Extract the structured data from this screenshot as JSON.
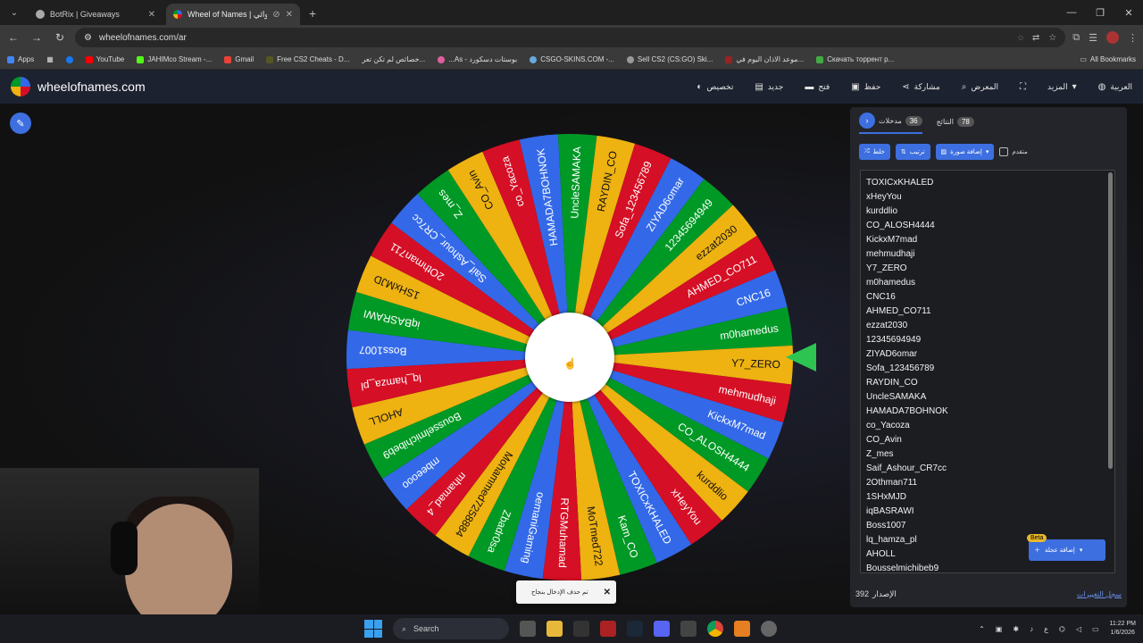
{
  "browser": {
    "tabs": [
      {
        "title": "BotRix | Giveaways",
        "active": false
      },
      {
        "title": "Wheel of Names | العشوائي",
        "active": true
      }
    ],
    "url": "wheelofnames.com/ar",
    "bookmarks": [
      "Apps",
      "YouTube",
      "JAHIMco Stream -...",
      "Gmail",
      "Free CS2 Cheats - D...",
      "خصائص لم تكن تعر...",
      "...As - بوستات دسكورد",
      "CSGO-SKINS.COM -...",
      "Sell CS2 (CS:GO) Ski...",
      "موعد الاذان اليوم في...",
      "Скачать торрент р..."
    ],
    "all_bookmarks": "All Bookmarks"
  },
  "header": {
    "site_name": "wheelofnames.com",
    "menu": [
      {
        "label": "العربية",
        "icon": "globe-icon"
      },
      {
        "label": "المزيد",
        "icon": "chevron-down-icon"
      },
      {
        "label": "",
        "icon": "fullscreen-icon"
      },
      {
        "label": "المعرض",
        "icon": "search-icon"
      },
      {
        "label": "مشاركة",
        "icon": "share-icon"
      },
      {
        "label": "حفظ",
        "icon": "save-icon"
      },
      {
        "label": "فتح",
        "icon": "folder-icon"
      },
      {
        "label": "جديد",
        "icon": "new-file-icon"
      },
      {
        "label": "تخصيص",
        "icon": "palette-icon"
      }
    ]
  },
  "panel": {
    "tab_entries_label": "مدخلات",
    "tab_entries_count": "36",
    "tab_results_label": "النتائج",
    "tab_results_count": "78",
    "shuffle_label": "خلط",
    "sort_label": "ترتيب",
    "add_image_label": "إضافة صورة",
    "advanced_label": "متقدم",
    "entries": [
      "TOXICxKHALED",
      "xHeyYou",
      "kurddlio",
      "CO_ALOSH4444",
      "KickxM7mad",
      "mehmudhaji",
      "Y7_ZERO",
      "m0hamedus",
      "CNC16",
      "AHMED_CO711",
      "ezzat2030",
      "12345694949",
      "ZIYAD6omar",
      "Sofa_123456789",
      "RAYDIN_CO",
      "UncleSAMAKA",
      "HAMADA7BOHNOK",
      "co_Yacoza",
      "CO_Avin",
      "Z_mes",
      "Saif_Ashour_CR7cc",
      "2Othman711",
      "1SHxMJD",
      "iqBASRAWI",
      "Boss1007",
      "lq_hamza_pl",
      "AHOLL",
      "Bousselmichibeb9"
    ],
    "beta_label": "Beta",
    "add_wheel_label": "إضافة عجلة",
    "version_label": "الإصدار",
    "version_number": "392",
    "changelog_label": "سجل التغييرات"
  },
  "wheel": {
    "slices": [
      "m0hamedus",
      "Y7_ZERO",
      "mehmudhaji",
      "KickxM7mad",
      "CO_ALOSH4444",
      "kurddlio",
      "xHeyYou",
      "TOXICxKHALED",
      "Kam_CO",
      "MoTmed722",
      "RTGMuhamad",
      "oemaniGaming",
      "Zbadr0sa",
      "Mohammed7258884",
      "mhamad_4",
      "mbeeooo",
      "Bousselmichibeb9",
      "AHOLL",
      "lq_hamza_pl",
      "Boss1007",
      "iqBASRAWI",
      "1SHxMJD",
      "2Othman711",
      "Saif_Ashour_CR7cc",
      "Z_mes",
      "CO_Avin",
      "co_Yacoza",
      "HAMADA7BOHNOK",
      "UncleSAMAKA",
      "RAYDIN_CO",
      "Sofa_123456789",
      "ZIYAD6omar",
      "12345694949",
      "ezzat2030",
      "AHMED_CO711",
      "CNC16"
    ],
    "colors": [
      "#009925",
      "#eeb211",
      "#d50f25",
      "#3369e8"
    ]
  },
  "toast": {
    "message": "تم حذف الإدخال بنجاح"
  },
  "taskbar": {
    "search_label": "Search",
    "time": "11:22 PM",
    "date": "1/6/2026",
    "lang": "ع"
  }
}
